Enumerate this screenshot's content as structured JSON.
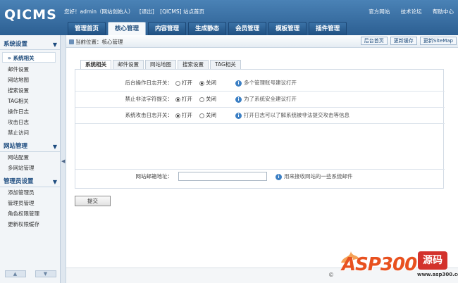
{
  "app": {
    "logo": "QICMS"
  },
  "top_info": {
    "greeting": "您好！admin（网站创始人）",
    "logout": "[退出]",
    "site_home": "[QICMS] 站点首页"
  },
  "top_links": [
    "官方网站",
    "技术论坛",
    "帮助中心"
  ],
  "nav": {
    "tabs": [
      {
        "label": "管理首页",
        "active": false
      },
      {
        "label": "核心管理",
        "active": true
      },
      {
        "label": "内容管理",
        "active": false
      },
      {
        "label": "生成静态",
        "active": false
      },
      {
        "label": "会员管理",
        "active": false
      },
      {
        "label": "模板管理",
        "active": false
      },
      {
        "label": "插件管理",
        "active": false
      }
    ]
  },
  "sidebar": {
    "sections": [
      {
        "title": "系统设置",
        "toggle": "▼",
        "items": [
          "系统相关",
          "邮件设置",
          "网站地图",
          "搜索设置",
          "TAG相关",
          "操作日志",
          "攻击日志",
          "禁止访问"
        ]
      },
      {
        "title": "网站管理",
        "toggle": "▼",
        "items": [
          "网站配置",
          "多网站管理"
        ]
      },
      {
        "title": "管理员设置",
        "toggle": "▼",
        "items": [
          "添加管理员",
          "管理员管理",
          "角色权限管理",
          "更新权限缓存"
        ]
      }
    ],
    "active_item": "系统相关",
    "footer_up": "▲",
    "footer_down": "▼"
  },
  "collapse_arrow": "◀",
  "breadcrumb": {
    "text": "当前位置：核心管理",
    "buttons": [
      "后台首页",
      "更新缓存",
      "更新SiteMap"
    ]
  },
  "tabs": [
    {
      "label": "系统相关",
      "active": true
    },
    {
      "label": "邮件设置",
      "active": false
    },
    {
      "label": "网站地图",
      "active": false
    },
    {
      "label": "搜索设置",
      "active": false
    },
    {
      "label": "TAG相关",
      "active": false
    }
  ],
  "form": {
    "rows": [
      {
        "label": "后台操作日志开关：",
        "on_label": "打开",
        "off_label": "关闭",
        "selected": "off",
        "hint": "多个管理账号建议打开"
      },
      {
        "label": "禁止非法字符提交：",
        "on_label": "打开",
        "off_label": "关闭",
        "selected": "on",
        "hint": "为了系统安全建议打开"
      },
      {
        "label": "系统攻击日志开关：",
        "on_label": "打开",
        "off_label": "关闭",
        "selected": "on",
        "hint": "打开日志可以了解系统被非法提交攻击等信息"
      }
    ],
    "email": {
      "label": "网站邮箱地址：",
      "value": "",
      "hint": "用来接收网站的一些系统邮件"
    },
    "submit_label": "提交"
  },
  "footer": {
    "copyright": "©"
  },
  "watermark": {
    "text": "ASP300",
    "badge": "源码",
    "url": "www.asp300.com"
  },
  "colors": {
    "header": "#2c5f92",
    "accent": "#1c4a7a",
    "info": "#3b7fc4",
    "watermark": "#e8511f"
  }
}
